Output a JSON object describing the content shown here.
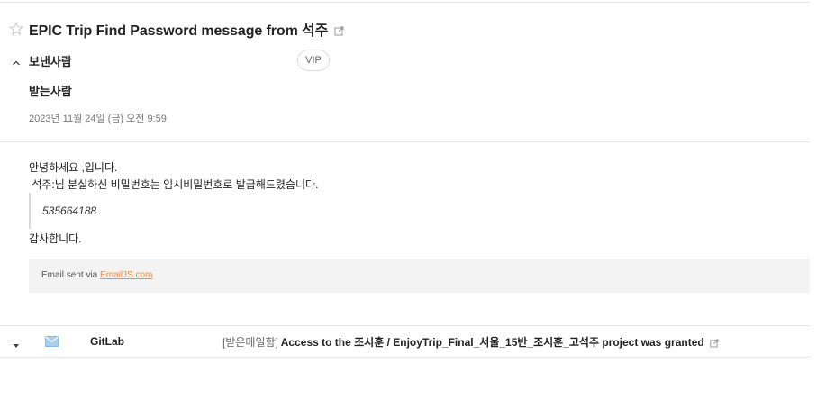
{
  "mail": {
    "subject": "EPIC Trip Find Password message from 석주",
    "sender_label": "보낸사람",
    "vip_label": "VIP",
    "recipient_label": "받는사람",
    "date": "2023년 11월 24일 (금) 오전 9:59"
  },
  "body": {
    "greeting": "안녕하세요 ,입니다.",
    "notice": " 석주:님 분실하신 비밀번호는 임시비밀번호로 발급해드렸습니다.",
    "temp_password": "535664188",
    "thanks": "감사합니다.",
    "footer_prefix": "Email sent via ",
    "footer_link": "EmailJS.com"
  },
  "list_row": {
    "sender": "GitLab",
    "folder": "[받은메일함]",
    "subject": " Access to the 조시훈 / EnjoyTrip_Final_서울_15반_조시훈_고석주 project was granted"
  },
  "colors": {
    "accent_link": "#f08a3e",
    "mail_icon": "#a9cdee",
    "divider": "#e6e6e6"
  },
  "icons": {
    "star": "star-icon",
    "external_link": "external-link-icon",
    "chevron_up": "chevron-up-icon",
    "caret_down": "caret-down-icon",
    "mail": "mail-icon"
  }
}
